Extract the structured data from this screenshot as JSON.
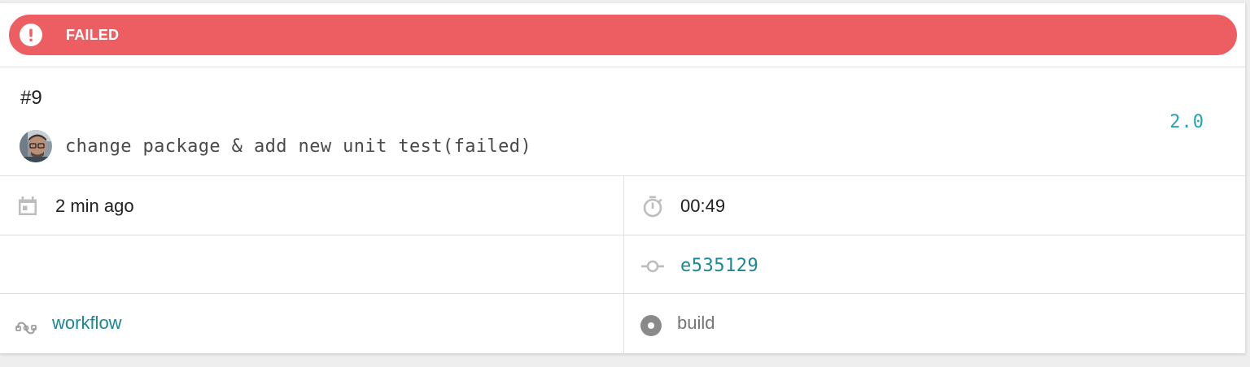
{
  "status": {
    "label": "FAILED",
    "color": "#ec5e61",
    "icon": "exclamation-icon"
  },
  "build": {
    "number": "#9",
    "commit_message": "change package & add new unit test(failed)",
    "branch": "2.0"
  },
  "details": {
    "created": "2 min ago",
    "duration": "00:49",
    "commit_sha": "e535129",
    "workflow": "workflow",
    "stage": "build"
  },
  "icons": {
    "created": "calendar-icon",
    "duration": "stopwatch-icon",
    "commit": "git-commit-icon",
    "workflow": "workflow-icon",
    "stage": "stage-dot-icon"
  },
  "colors": {
    "accent_link": "#1a8796",
    "branch_link": "#1ea5b6",
    "failed": "#ec5e61"
  }
}
